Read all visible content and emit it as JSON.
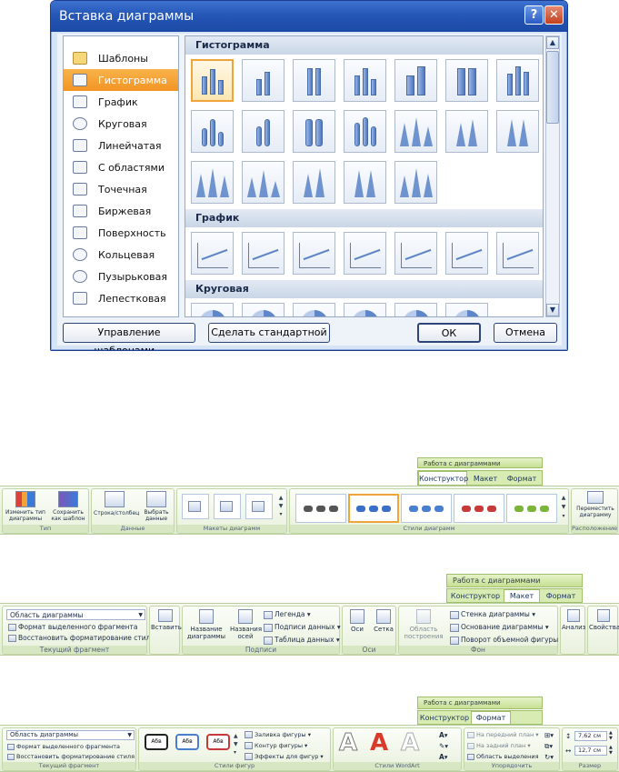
{
  "dialog": {
    "title": "Вставка диаграммы",
    "help_glyph": "?",
    "close_glyph": "✕",
    "left_items": [
      {
        "label": "Шаблоны",
        "icon": "folder-icon"
      },
      {
        "label": "Гистограмма",
        "icon": "column-chart-icon",
        "selected": true
      },
      {
        "label": "График",
        "icon": "line-chart-icon"
      },
      {
        "label": "Круговая",
        "icon": "pie-chart-icon"
      },
      {
        "label": "Линейчатая",
        "icon": "bar-chart-icon"
      },
      {
        "label": "С областями",
        "icon": "area-chart-icon"
      },
      {
        "label": "Точечная",
        "icon": "scatter-chart-icon"
      },
      {
        "label": "Биржевая",
        "icon": "stock-chart-icon"
      },
      {
        "label": "Поверхность",
        "icon": "surface-chart-icon"
      },
      {
        "label": "Кольцевая",
        "icon": "doughnut-chart-icon"
      },
      {
        "label": "Пузырьковая",
        "icon": "bubble-chart-icon"
      },
      {
        "label": "Лепестковая",
        "icon": "radar-chart-icon"
      }
    ],
    "sections": [
      "Гистограмма",
      "График",
      "Круговая"
    ],
    "buttons": {
      "manage": "Управление шаблонами...",
      "default": "Сделать стандартной",
      "ok": "ОК",
      "cancel": "Отмена"
    },
    "colors": {
      "title_bar": "#2557b7",
      "selection": "#f39425"
    }
  },
  "ribbon1": {
    "context_title": "Работа с диаграммами",
    "tabs": [
      "Конструктор",
      "Макет",
      "Формат"
    ],
    "active_tab": "Конструктор",
    "groups": {
      "type": {
        "label": "Тип",
        "btn1": "Изменить тип диаграммы",
        "btn2": "Сохранить как шаблон"
      },
      "data": {
        "label": "Данные",
        "btn1": "Строка/столбец",
        "btn2": "Выбрать данные"
      },
      "layouts": {
        "label": "Макеты диаграмм"
      },
      "styles": {
        "label": "Стили диаграмм"
      },
      "location": {
        "label": "Расположение",
        "btn1": "Переместить диаграмму"
      }
    }
  },
  "ribbon2": {
    "context_title": "Работа с диаграммами",
    "tabs": [
      "Конструктор",
      "Макет",
      "Формат"
    ],
    "active_tab": "Макет",
    "fragment": {
      "combo": "Область диаграммы",
      "item1": "Формат выделенного фрагмента",
      "item2": "Восстановить форматирование стиля",
      "label": "Текущий фрагмент"
    },
    "insert": {
      "btn": "Вставить"
    },
    "labels": {
      "label": "Подписи",
      "chart_title": "Название диаграммы",
      "axis_titles": "Названия осей",
      "legend": "Легенда",
      "data_labels": "Подписи данных",
      "data_table": "Таблица данных"
    },
    "axes": {
      "label": "Оси",
      "axes": "Оси",
      "grid": "Сетка"
    },
    "background": {
      "label": "Фон",
      "plot_area": "Область построения",
      "wall": "Стенка диаграммы",
      "floor": "Основание диаграммы",
      "rotation": "Поворот объемной фигуры"
    },
    "analysis": "Анализ",
    "properties": "Свойства"
  },
  "ribbon3": {
    "context_title": "Работа с диаграммами",
    "tabs": [
      "Конструктор",
      "Формат"
    ],
    "active_tab": "Формат",
    "fragment": {
      "combo": "Область диаграммы",
      "item1": "Формат выделенного фрагмента",
      "item2": "Восстановить форматирование стиля",
      "label": "Текущий фрагмент"
    },
    "shape_styles": {
      "label": "Стили фигур",
      "sample": "Абв",
      "fill": "Заливка фигуры",
      "outline": "Контур фигуры",
      "effects": "Эффекты для фигур"
    },
    "wordart": {
      "label": "Стили WordArt",
      "letter": "A"
    },
    "arrange": {
      "label": "Упорядочить",
      "front": "На передний план",
      "back": "На задний план",
      "selection": "Область выделения"
    },
    "size": {
      "label": "Размер",
      "height": "7,62 см",
      "width": "12,7 см"
    }
  }
}
